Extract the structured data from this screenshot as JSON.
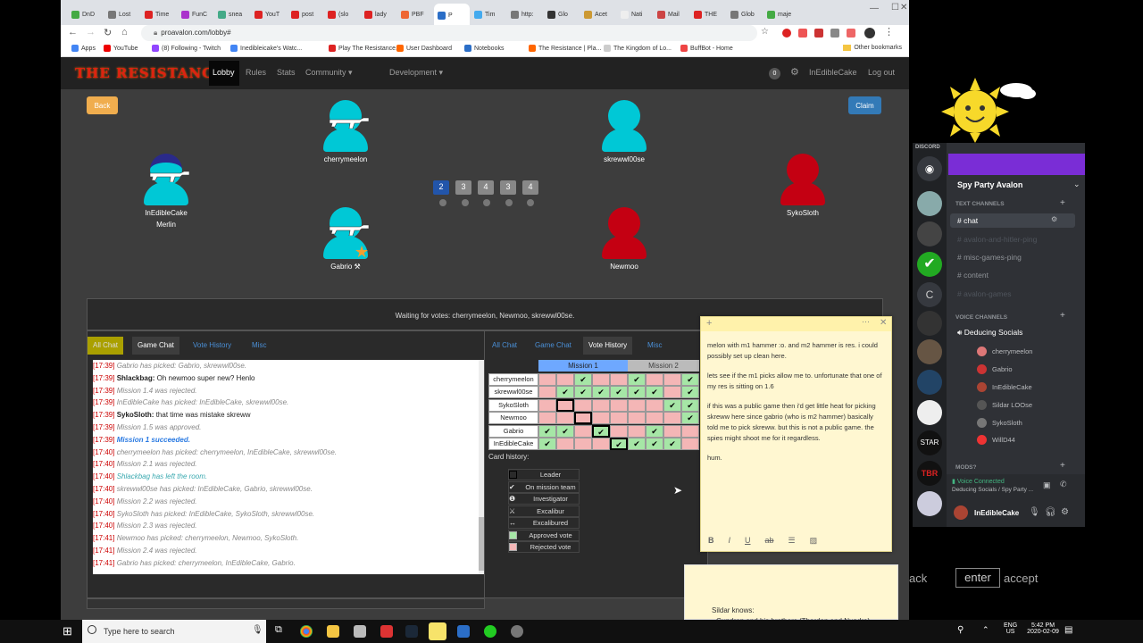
{
  "browser": {
    "tabs": [
      "DnD",
      "Lost",
      "Time",
      "FunC",
      "snea",
      "YouT",
      "post",
      "(slo",
      "lady",
      "PBF",
      "P",
      "Tim",
      "http:",
      "Glo",
      "Acet",
      "Nati",
      "Mail",
      "THE",
      "Glob",
      "maje"
    ],
    "url": "proavalon.com/lobby#",
    "bookmarks": [
      "Apps",
      "YouTube",
      "(8) Following - Twitch",
      "Inedibleicake's Watc...",
      "Play The Resistance...",
      "User Dashboard",
      "Notebooks",
      "The Resistance | Pla...",
      "The Kingdom of Lo...",
      "BuffBot - Home"
    ],
    "other_bookmarks": "Other bookmarks"
  },
  "site": {
    "logo": "THE RESISTANCE",
    "nav": [
      "Lobby",
      "Rules",
      "Stats",
      "Community",
      "Development"
    ],
    "notif_count": "0",
    "username": "InEdibleCake",
    "logout": "Log out",
    "back": "Back",
    "claim": "Claim"
  },
  "players": [
    {
      "name": "cherrymeelon",
      "color": "#00c8d6"
    },
    {
      "name": "skrewwl00se",
      "color": "#00c8d6"
    },
    {
      "name": "InEdibleCake",
      "role": "Merlin",
      "color": "#00c8d6"
    },
    {
      "name": "SykoSloth",
      "color": "#c40012"
    },
    {
      "name": "Gabrio",
      "color": "#00c8d6"
    },
    {
      "name": "Newmoo",
      "color": "#c40012"
    }
  ],
  "missions": [
    "2",
    "3",
    "4",
    "3",
    "4"
  ],
  "status": "Waiting for votes: cherrymeelon, Newmoo, skrewwl00se.",
  "chat_tabs": [
    "All Chat",
    "Game Chat",
    "Vote History",
    "Misc"
  ],
  "chat": [
    {
      "t": "[17:39]",
      "m": "Gabrio has picked: Gabrio, skrewwl00se.",
      "k": "sys"
    },
    {
      "t": "[17:39]",
      "u": "Shlackbag:",
      "m": " Oh newmoo super new? Henlo",
      "k": "user"
    },
    {
      "t": "[17:39]",
      "m": "Mission 1.4 was rejected.",
      "k": "sys"
    },
    {
      "t": "[17:39]",
      "m": "InEdibleCake has picked: InEdibleCake, skrewwl00se.",
      "k": "sys"
    },
    {
      "t": "[17:39]",
      "u": "SykoSloth:",
      "m": " that time was mistake skreww",
      "k": "user"
    },
    {
      "t": "[17:39]",
      "m": "Mission 1.5 was approved.",
      "k": "sys"
    },
    {
      "t": "[17:39]",
      "m": "Mission 1 succeeded.",
      "k": "win"
    },
    {
      "t": "[17:40]",
      "m": "cherrymeelon has picked: cherrymeelon, InEdibleCake, skrewwl00se.",
      "k": "sys"
    },
    {
      "t": "[17:40]",
      "m": "Mission 2.1 was rejected.",
      "k": "sys"
    },
    {
      "t": "[17:40]",
      "m": "Shlackbag has left the room.",
      "k": "leave"
    },
    {
      "t": "[17:40]",
      "m": "skrewwl00se has picked: InEdibleCake, Gabrio, skrewwl00se.",
      "k": "sys"
    },
    {
      "t": "[17:40]",
      "m": "Mission 2.2 was rejected.",
      "k": "sys"
    },
    {
      "t": "[17:40]",
      "m": "SykoSloth has picked: InEdibleCake, SykoSloth, skrewwl00se.",
      "k": "sys"
    },
    {
      "t": "[17:40]",
      "m": "Mission 2.3 was rejected.",
      "k": "sys"
    },
    {
      "t": "[17:41]",
      "m": "Newmoo has picked: cherrymeelon, Newmoo, SykoSloth.",
      "k": "sys"
    },
    {
      "t": "[17:41]",
      "m": "Mission 2.4 was rejected.",
      "k": "sys"
    },
    {
      "t": "[17:41]",
      "m": "Gabrio has picked: cherrymeelon, InEdibleCake, Gabrio.",
      "k": "sys"
    }
  ],
  "vote_history": {
    "headers": [
      "Mission 1",
      "Mission 2"
    ],
    "rows": [
      {
        "name": "cherrymeelon",
        "cells": [
          "r",
          "r",
          "ac",
          "r",
          "r",
          "ac",
          "r",
          "r",
          "ac"
        ]
      },
      {
        "name": "skrewwl00se",
        "cells": [
          "r",
          "ac",
          "ac",
          "ac",
          "ac",
          "ac",
          "ac",
          "r",
          "ac"
        ]
      },
      {
        "name": "SykoSloth",
        "cells": [
          "r",
          "rL",
          "r",
          "r",
          "r",
          "r",
          "r",
          "ac",
          "ac"
        ]
      },
      {
        "name": "Newmoo",
        "cells": [
          "r",
          "r",
          "rL",
          "r",
          "r",
          "r",
          "r",
          "r",
          "ac"
        ]
      },
      {
        "name": "Gabrio",
        "cells": [
          "ac",
          "ac",
          "r",
          "acL",
          "r",
          "r",
          "ac",
          "r",
          "r"
        ]
      },
      {
        "name": "InEdibleCake",
        "cells": [
          "ac",
          "r",
          "r",
          "r",
          "acL",
          "ac",
          "ac",
          "ac",
          "r"
        ]
      }
    ],
    "card_history": "Card history:",
    "legend": [
      "Leader",
      "On mission team",
      "Investigator",
      "Excalibur",
      "Excalibured",
      "Approved vote",
      "Rejected vote"
    ]
  },
  "sticky": {
    "notes": [
      "melon with m1 hammer :o. and m2 hammer is res. i could possibly set up clean here.",
      "lets see if the m1 picks allow me to. unfortunate that one of my res is sitting on 1.6",
      "if this was a public game then i'd get little heat for picking skreww here since gabrio (who is m2 hammer) basically told me to pick skreww. but this is not a public game. the spies might shoot me for it regardless.",
      "hum."
    ]
  },
  "sticky2": {
    "line1": "Sildar knows:",
    "line2": "• Gundren and his brothers (Tharden and Nundro)"
  },
  "discord": {
    "label": "DISCORD",
    "server": "Spy Party Avalon",
    "text_channels_label": "TEXT CHANNELS",
    "channels": [
      "chat",
      "avalon-and-hitler-ping",
      "misc-games-ping",
      "content",
      "avalon-games"
    ],
    "voice_label": "VOICE CHANNELS",
    "voice_channel": "Deducing Socials",
    "voice_users": [
      "cherrymeelon",
      "Gabrio",
      "InEdibleCake",
      "Sildar LOOse",
      "SykoSloth",
      "WillD44"
    ],
    "mods": "MODS?",
    "connected": "Voice Connected",
    "connected_sub": "Deducing Socials / Spy Party ...",
    "me": "InEdibleCake"
  },
  "overlay": {
    "back": "ack",
    "enter": "enter",
    "accept": "accept"
  },
  "taskbar": {
    "search": "Type here to search",
    "lang": "ENG",
    "region": "US",
    "time": "5:42 PM",
    "date": "2020-02-09"
  }
}
